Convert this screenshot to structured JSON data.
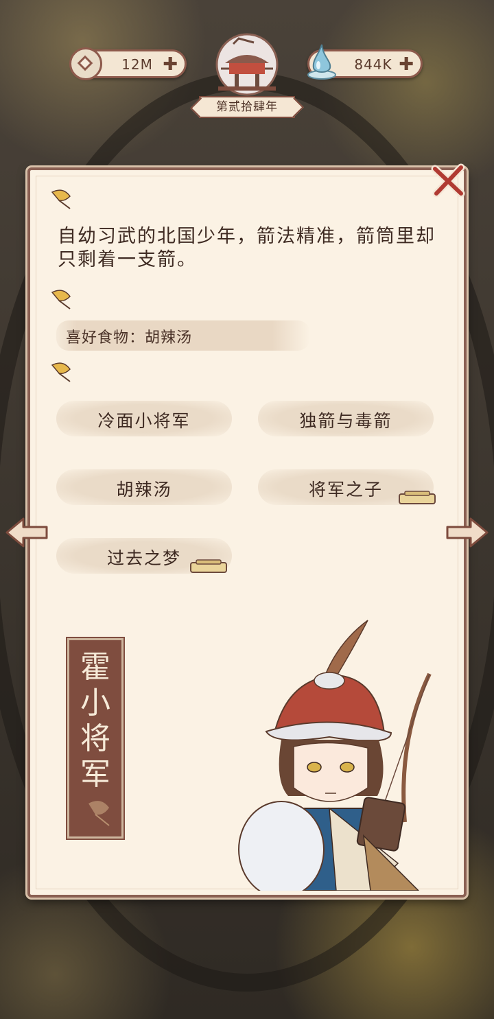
{
  "resources": {
    "coins": "12M",
    "essence": "844K"
  },
  "year_label": "第贰拾肆年",
  "description": "自幼习武的北国少年，箭法精准，箭筒里却只剩着一支箭。",
  "favorite_food": "喜好食物：胡辣汤",
  "story_tags": [
    {
      "label": "冷面小将军",
      "locked": false
    },
    {
      "label": "独箭与毒箭",
      "locked": false
    },
    {
      "label": "胡辣汤",
      "locked": false
    },
    {
      "label": "将军之子",
      "locked": true
    },
    {
      "label": "过去之梦",
      "locked": true
    }
  ],
  "character_name": "霍小将军",
  "icons": {
    "coin": "coin-icon",
    "essence": "water-drop-icon",
    "close": "close-icon",
    "leaf": "ginkgo-leaf-icon",
    "prev": "arrow-left-icon",
    "next": "arrow-right-icon"
  },
  "colors": {
    "panel": "#fbf2e4",
    "frame": "#8a6053",
    "text": "#3e2a22",
    "close": "#b03a32"
  }
}
